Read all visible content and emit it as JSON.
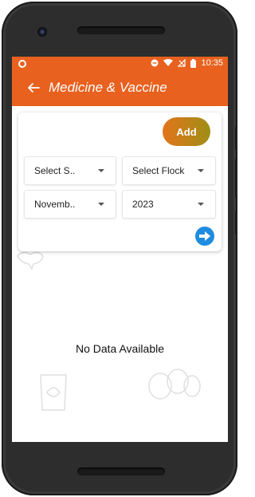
{
  "status_bar": {
    "time": "10:35"
  },
  "app_bar": {
    "title": "Medicine & Vaccine"
  },
  "actions": {
    "add_label": "Add"
  },
  "filters": {
    "shed_select": "Select S..",
    "flock_select": "Select Flock",
    "month_select": "Novemb..",
    "year_select": "2023"
  },
  "content": {
    "empty_message": "No Data Available"
  },
  "colors": {
    "accent": "#e8611f",
    "add_gradient_start": "#e2741b",
    "add_gradient_end": "#9f8f16",
    "go_button": "#1f8ce0"
  },
  "icons": {
    "back": "arrow-left-icon",
    "go": "arrow-right-icon",
    "dnd": "do-not-disturb-icon",
    "wifi": "wifi-icon",
    "battery": "battery-icon"
  }
}
